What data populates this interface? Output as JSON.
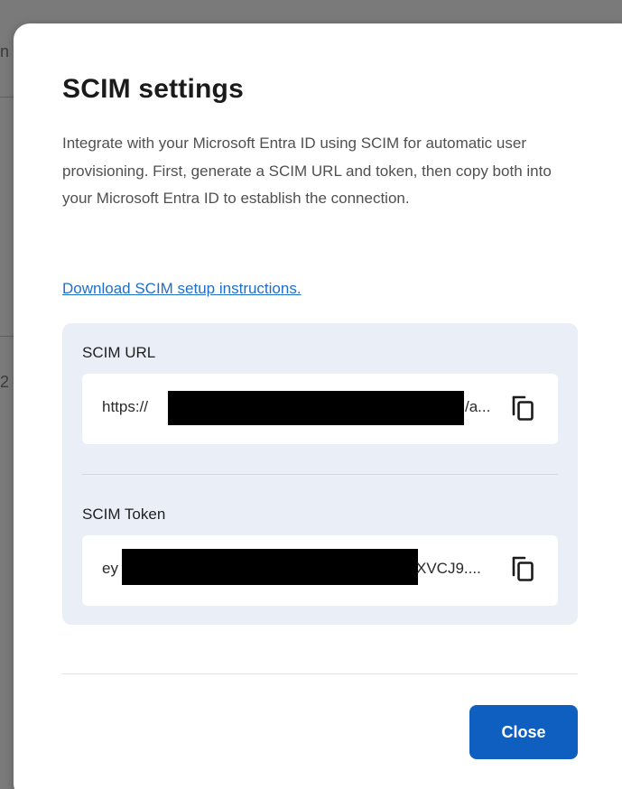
{
  "background": {
    "partial_chars": [
      "n",
      "2"
    ]
  },
  "dialog": {
    "title": "SCIM settings",
    "description": "Integrate with your Microsoft Entra ID using SCIM for automatic user provisioning. First, generate a SCIM URL and token, then copy both into your Microsoft Entra ID to establish the connection.",
    "download_link": "Download SCIM setup instructions.",
    "fields": {
      "url": {
        "label": "SCIM URL",
        "value_start": "https://",
        "value_end": "/a...",
        "copy_icon": "copy-icon"
      },
      "token": {
        "label": "SCIM Token",
        "value_start": "ey",
        "value_end": "XVCJ9....",
        "copy_icon": "copy-icon"
      }
    },
    "close_label": "Close"
  },
  "colors": {
    "primary_button": "#0f5fc0",
    "link": "#1f6fc9",
    "panel_background": "#e9eef7",
    "overlay": "#6e6e6e"
  }
}
